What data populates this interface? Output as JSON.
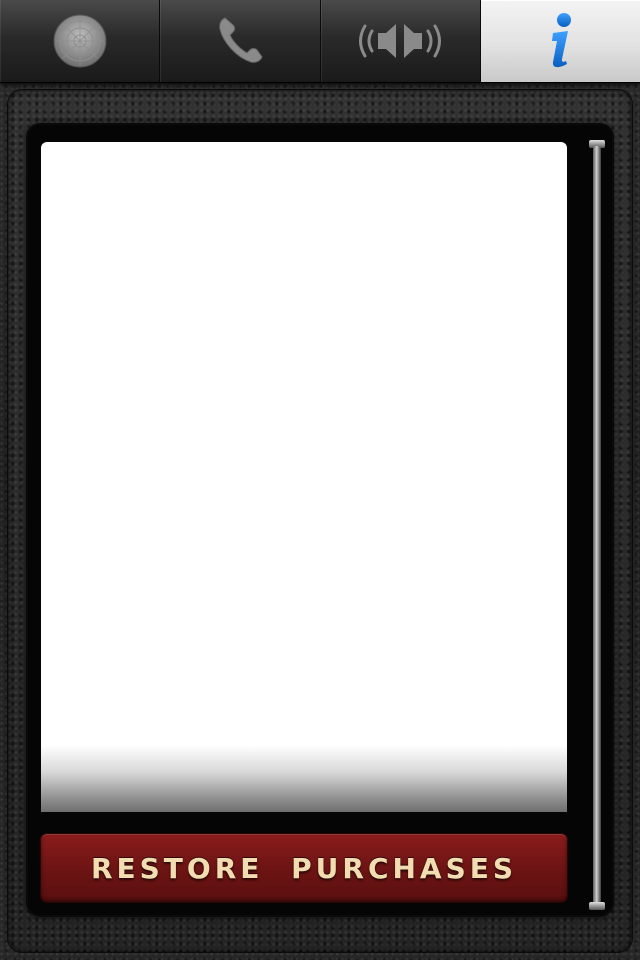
{
  "tabs": [
    {
      "name": "radar",
      "icon": "radar-icon",
      "active": false
    },
    {
      "name": "phone",
      "icon": "phone-icon",
      "active": false
    },
    {
      "name": "speaker",
      "icon": "speaker-icon",
      "active": false
    },
    {
      "name": "info",
      "icon": "info-icon",
      "active": true
    }
  ],
  "restore_button": {
    "label": "RESTORE PURCHASES"
  },
  "colors": {
    "accent_info": "#1a7fe0",
    "button_red": "#7a1616",
    "button_text": "#f2ddb0"
  }
}
